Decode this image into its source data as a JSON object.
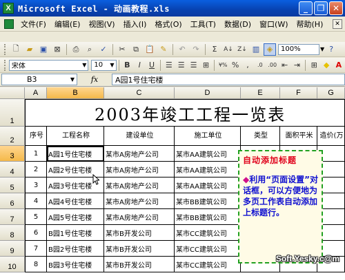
{
  "window": {
    "title": "Microsoft Excel - 动画教程.xls",
    "app_icon_glyph": "X"
  },
  "menu": [
    "文件(F)",
    "编辑(E)",
    "视图(V)",
    "插入(I)",
    "格式(O)",
    "工具(T)",
    "数据(D)",
    "窗口(W)",
    "帮助(H)"
  ],
  "toolbar": {
    "zoom": "100%",
    "font_name": "宋体",
    "font_size": "10"
  },
  "formula_bar": {
    "name_box": "B3",
    "fx": "fx",
    "content": "A园1号住宅楼"
  },
  "columns": [
    "A",
    "B",
    "C",
    "D",
    "E",
    "F",
    "G"
  ],
  "rows": [
    "1",
    "2",
    "3",
    "4",
    "5",
    "6",
    "7",
    "8",
    "9",
    "10"
  ],
  "sheet": {
    "title": "2003年竣工工程一览表",
    "headers": [
      "序号",
      "工程名称",
      "建设单位",
      "施工单位",
      "类型",
      "面积平米",
      "造价(万"
    ],
    "data": [
      [
        "1",
        "A园1号住宅楼",
        "某市A房地产公司",
        "某市AA建筑公司"
      ],
      [
        "2",
        "A园2号住宅楼",
        "某市A房地产公司",
        "某市AA建筑公司"
      ],
      [
        "3",
        "A园3号住宅楼",
        "某市A房地产公司",
        "某市AA建筑公司"
      ],
      [
        "4",
        "A园4号住宅楼",
        "某市A房地产公司",
        "某市BB建筑公司"
      ],
      [
        "5",
        "A园5号住宅楼",
        "某市A房地产公司",
        "某市BB建筑公司"
      ],
      [
        "6",
        "B园1号住宅楼",
        "某市B开发公司",
        "某市CC建筑公司"
      ],
      [
        "7",
        "B园2号住宅楼",
        "某市B开发公司",
        "某市CC建筑公司"
      ],
      [
        "8",
        "B园3号住宅楼",
        "某市B开发公司",
        "某市CC建筑公司"
      ]
    ]
  },
  "callout": {
    "title": "自动添加标题",
    "bullet": "◆",
    "body": "利用“页面设置”对话框，可以方便地为多页工作表自动添加上标题行。"
  },
  "watermark": "Soft.Yesky.c@m"
}
